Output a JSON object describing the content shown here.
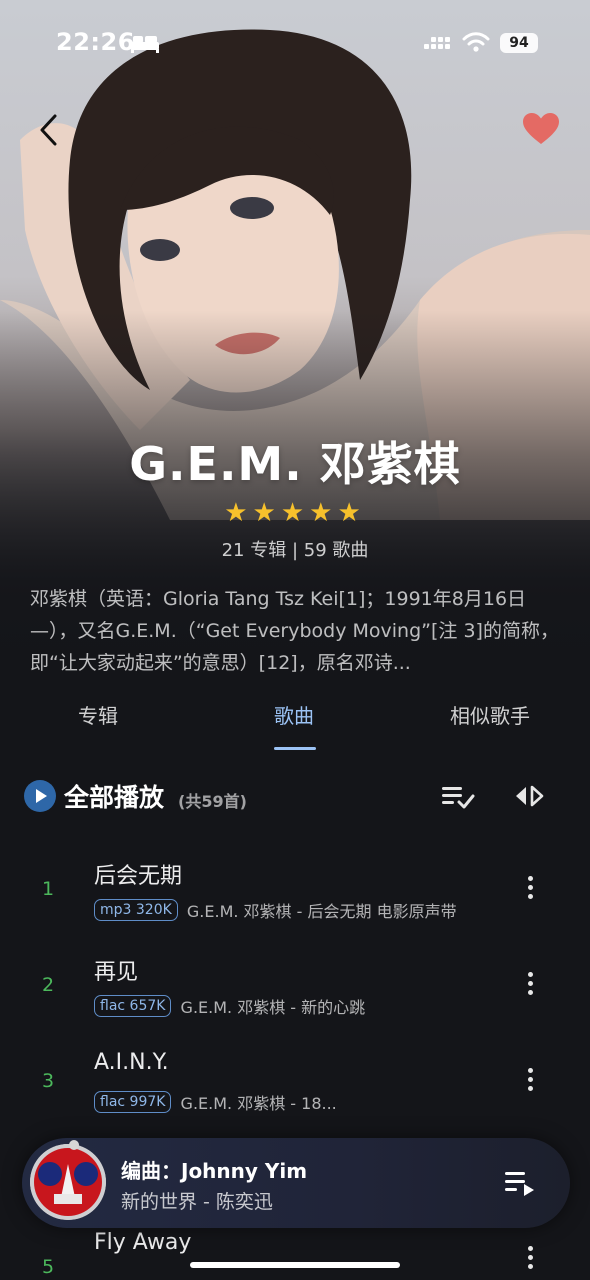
{
  "status_bar": {
    "time": "22:26",
    "battery": "94"
  },
  "artist": {
    "name": "G.E.M. 邓紫棋",
    "rating": 5,
    "stars": "★★★★★",
    "counts": "21 专辑 | 59 歌曲",
    "bio": "邓紫棋（英语：Gloria Tang Tsz Kei[1]；1991年8月16日—），又名G.E.M.（“Get Everybody Moving”[注 3]的简称，即“让大家动起来”的意思）[12]，原名邓诗..."
  },
  "tabs": [
    {
      "label": "专辑"
    },
    {
      "label": "歌曲"
    },
    {
      "label": "相似歌手"
    }
  ],
  "play_all": {
    "label": "全部播放",
    "count": "(共59首)"
  },
  "songs": [
    {
      "index": "1",
      "title": "后会无期",
      "badge": "mp3 320K",
      "detail": "G.E.M. 邓紫棋 - 后会无期 电影原声带"
    },
    {
      "index": "2",
      "title": "再见",
      "badge": "flac 657K",
      "detail": "G.E.M. 邓紫棋 - 新的心跳"
    },
    {
      "index": "3",
      "title": "A.I.N.Y.",
      "badge": "flac 997K",
      "detail": "G.E.M. 邓紫棋 - 18..."
    },
    {
      "index": "5",
      "title": "Fly Away",
      "badge": "",
      "detail": ""
    }
  ],
  "now_playing": {
    "title": "编曲：Johnny Yim",
    "subtitle": "新的世界 - 陈奕迅"
  },
  "colors": {
    "background": "#141519",
    "accent_blue": "#9cc3f5",
    "index_green": "#4cb85c",
    "star": "#f7c12c",
    "heart": "#e46a64"
  }
}
